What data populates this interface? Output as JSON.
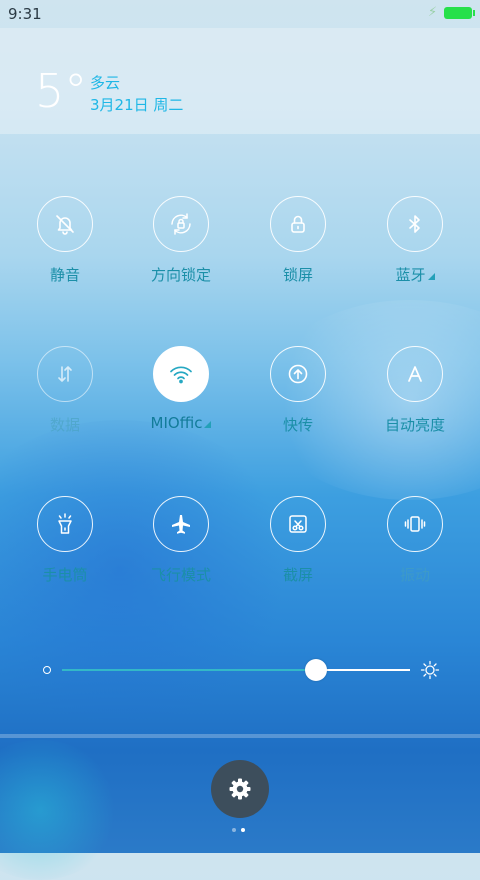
{
  "status_bar": {
    "time": "9:31",
    "battery_color": "#26e04a"
  },
  "weather": {
    "temperature": "5°",
    "condition": "多云",
    "date": "3月21日 周二",
    "accent_color": "#1fb7e6"
  },
  "toggles": [
    {
      "label": "静音",
      "icon": "bell-off-icon",
      "state": "off"
    },
    {
      "label": "方向锁定",
      "icon": "rotation-lock-icon",
      "state": "off"
    },
    {
      "label": "锁屏",
      "icon": "lock-icon",
      "state": "off"
    },
    {
      "label": "蓝牙",
      "icon": "bluetooth-icon",
      "state": "off",
      "has_submenu": true
    },
    {
      "label": "数据",
      "icon": "data-arrows-icon",
      "state": "disabled"
    },
    {
      "label": "MIOffic",
      "icon": "wifi-icon",
      "state": "on",
      "has_submenu": true
    },
    {
      "label": "快传",
      "icon": "share-upload-icon",
      "state": "off"
    },
    {
      "label": "自动亮度",
      "icon": "auto-brightness-icon",
      "state": "off"
    },
    {
      "label": "手电筒",
      "icon": "flashlight-icon",
      "state": "off"
    },
    {
      "label": "飞行模式",
      "icon": "airplane-icon",
      "state": "off"
    },
    {
      "label": "截屏",
      "icon": "screenshot-icon",
      "state": "off"
    },
    {
      "label": "振动",
      "icon": "vibrate-icon",
      "state": "dim"
    }
  ],
  "brightness": {
    "level": 0.73,
    "fill_color": "#33b8c7"
  },
  "settings_button": {
    "icon": "gear-icon"
  },
  "page_indicator": {
    "count": 2,
    "active": 1
  }
}
